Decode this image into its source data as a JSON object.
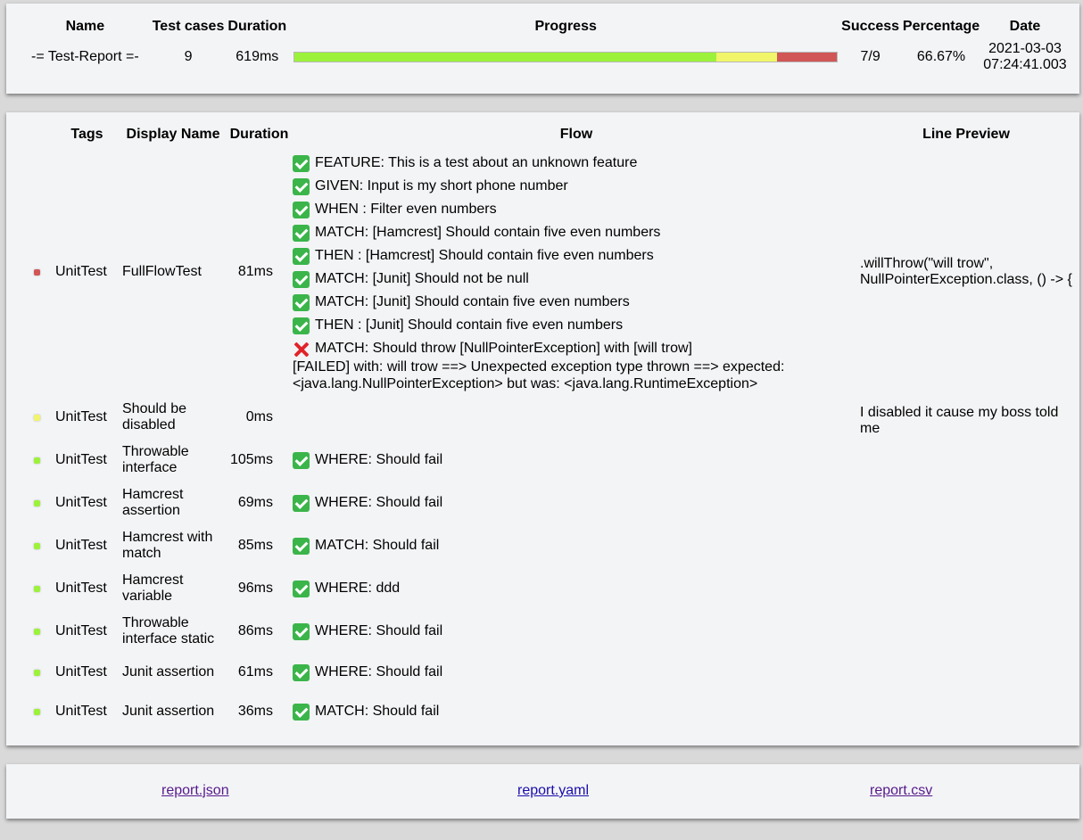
{
  "summary": {
    "headers": {
      "name": "Name",
      "test_cases": "Test cases",
      "duration": "Duration",
      "progress": "Progress",
      "success": "Success",
      "percentage": "Percentage",
      "date": "Date"
    },
    "row": {
      "name": "-= Test-Report =-",
      "test_cases": "9",
      "duration": "619ms",
      "success": "7/9",
      "percentage": "66.67%",
      "date_line1": "2021-03-03",
      "date_line2": "07:24:41.003"
    },
    "progress": {
      "passed_fraction": 0.7778,
      "skipped_fraction": 0.1111,
      "failed_fraction": 0.1111
    }
  },
  "results": {
    "headers": {
      "tags": "Tags",
      "display_name": "Display Name",
      "duration": "Duration",
      "flow": "Flow",
      "line_preview": "Line Preview"
    },
    "rows": [
      {
        "status": "failed",
        "status_color": "#d15656",
        "tag": "UnitTest",
        "name": "FullFlowTest",
        "duration": "81ms",
        "steps": [
          {
            "icon": "check-icon",
            "text": "FEATURE: This is a test about an unknown feature"
          },
          {
            "icon": "check-icon",
            "text": "GIVEN: Input is my short phone number"
          },
          {
            "icon": "check-icon",
            "text": "WHEN : Filter even numbers"
          },
          {
            "icon": "check-icon",
            "text": "MATCH: [Hamcrest] Should contain five even numbers"
          },
          {
            "icon": "check-icon",
            "text": "THEN : [Hamcrest] Should contain five even numbers"
          },
          {
            "icon": "check-icon",
            "text": "MATCH: [Junit] Should not be null"
          },
          {
            "icon": "check-icon",
            "text": "MATCH: [Junit] Should contain five even numbers"
          },
          {
            "icon": "check-icon",
            "text": "THEN : [Junit] Should contain five even numbers"
          },
          {
            "icon": "cross-icon",
            "text": "MATCH: Should throw [NullPointerException] with [will trow]"
          }
        ],
        "failure_message": "[FAILED] with: will trow ==> Unexpected exception type thrown ==> expected: <java.lang.NullPointerException> but was: <java.lang.RuntimeException>",
        "preview": ".willThrow(\"will trow\", NullPointerException.class, () -> {"
      },
      {
        "status": "skipped",
        "status_color": "#f1f56a",
        "tag": "UnitTest",
        "name": "Should be disabled",
        "duration": "0ms",
        "steps": [],
        "preview": "I disabled it cause my boss told me"
      },
      {
        "status": "passed",
        "status_color": "#9cf23a",
        "tag": "UnitTest",
        "name": "Throwable interface",
        "duration": "105ms",
        "steps": [
          {
            "icon": "check-icon",
            "text": "WHERE: Should fail"
          }
        ],
        "preview": ""
      },
      {
        "status": "passed",
        "status_color": "#9cf23a",
        "tag": "UnitTest",
        "name": "Hamcrest assertion",
        "duration": "69ms",
        "steps": [
          {
            "icon": "check-icon",
            "text": "WHERE: Should fail"
          }
        ],
        "preview": ""
      },
      {
        "status": "passed",
        "status_color": "#9cf23a",
        "tag": "UnitTest",
        "name": "Hamcrest with match",
        "duration": "85ms",
        "steps": [
          {
            "icon": "check-icon",
            "text": "MATCH: Should fail"
          }
        ],
        "preview": ""
      },
      {
        "status": "passed",
        "status_color": "#9cf23a",
        "tag": "UnitTest",
        "name": "Hamcrest variable",
        "duration": "96ms",
        "steps": [
          {
            "icon": "check-icon",
            "text": "WHERE: ddd"
          }
        ],
        "preview": ""
      },
      {
        "status": "passed",
        "status_color": "#9cf23a",
        "tag": "UnitTest",
        "name": "Throwable interface static",
        "duration": "86ms",
        "steps": [
          {
            "icon": "check-icon",
            "text": "WHERE: Should fail"
          }
        ],
        "preview": ""
      },
      {
        "status": "passed",
        "status_color": "#9cf23a",
        "tag": "UnitTest",
        "name": "Junit assertion",
        "duration": "61ms",
        "steps": [
          {
            "icon": "check-icon",
            "text": "WHERE: Should fail"
          }
        ],
        "preview": ""
      },
      {
        "status": "passed",
        "status_color": "#9cf23a",
        "tag": "UnitTest",
        "name": "Junit assertion",
        "duration": "36ms",
        "steps": [
          {
            "icon": "check-icon",
            "text": "MATCH: Should fail"
          }
        ],
        "preview": ""
      }
    ]
  },
  "links": {
    "json": "report.json",
    "yaml": "report.yaml",
    "csv": "report.csv"
  }
}
